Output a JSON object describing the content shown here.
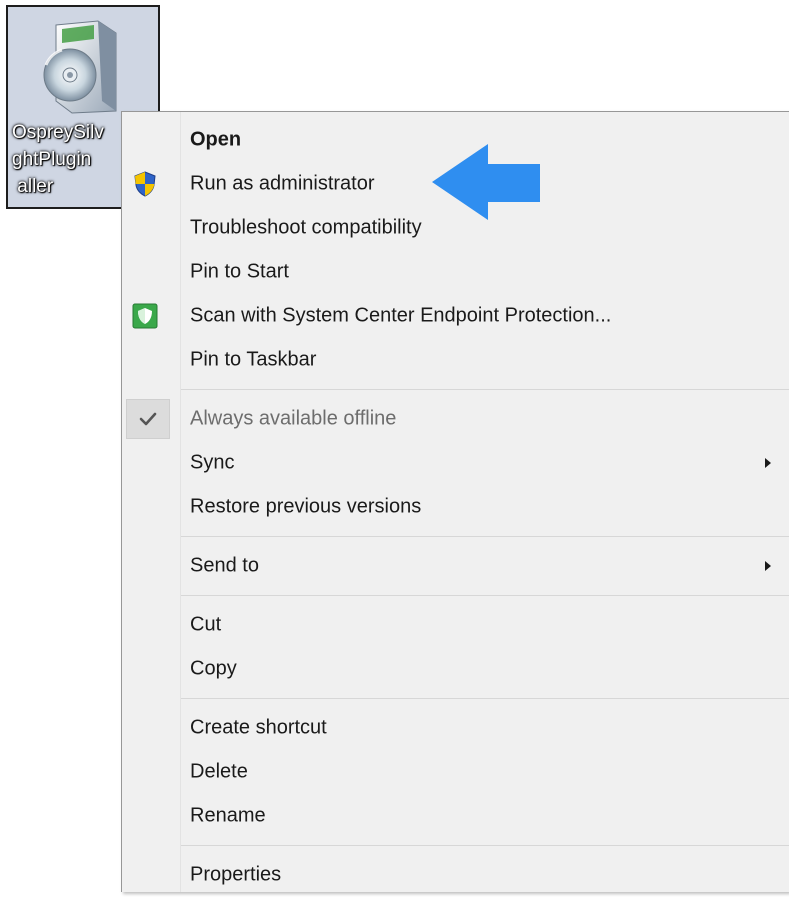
{
  "file": {
    "caption": "OspreySilv\nghtPlugin\n aller",
    "icon": "installer-box-cd-icon"
  },
  "menu": {
    "groups": [
      [
        {
          "label": "Open",
          "bold": true,
          "icon": ""
        },
        {
          "label": "Run as administrator",
          "icon": "uac-shield-icon"
        },
        {
          "label": "Troubleshoot compatibility",
          "icon": ""
        },
        {
          "label": "Pin to Start",
          "icon": ""
        },
        {
          "label": "Scan with System Center Endpoint Protection...",
          "icon": "endpoint-protection-icon"
        },
        {
          "label": "Pin to Taskbar",
          "icon": ""
        }
      ],
      [
        {
          "label": "Always available offline",
          "icon": "checkmark-icon",
          "disabled": true
        },
        {
          "label": "Sync",
          "icon": "",
          "submenu": true
        },
        {
          "label": "Restore previous versions",
          "icon": ""
        }
      ],
      [
        {
          "label": "Send to",
          "icon": "",
          "submenu": true
        }
      ],
      [
        {
          "label": "Cut",
          "icon": ""
        },
        {
          "label": "Copy",
          "icon": ""
        }
      ],
      [
        {
          "label": "Create shortcut",
          "icon": ""
        },
        {
          "label": "Delete",
          "icon": ""
        },
        {
          "label": "Rename",
          "icon": ""
        }
      ],
      [
        {
          "label": "Properties",
          "icon": ""
        }
      ]
    ]
  },
  "colors": {
    "arrow": "#2f8ef0",
    "shield_blue": "#2f64c8",
    "shield_yellow": "#f5c400",
    "protection_green": "#3aa84a"
  }
}
